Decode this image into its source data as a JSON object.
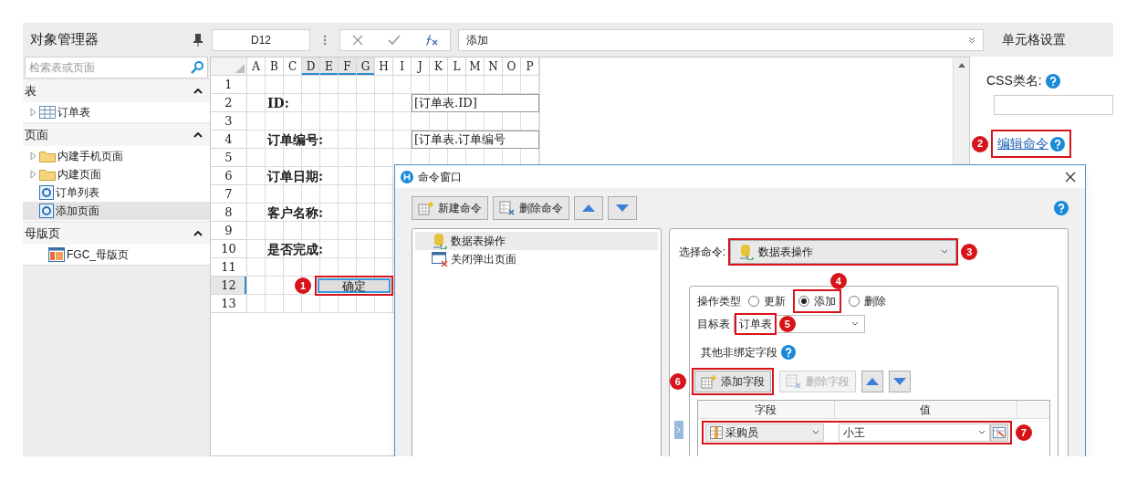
{
  "object_manager": {
    "title": "对象管理器",
    "search": {
      "placeholder": "检索表或页面"
    },
    "sections": [
      {
        "title": "表",
        "expanded": true,
        "items": [
          {
            "label": "订单表",
            "kind": "table",
            "expanded": false,
            "selected": false
          }
        ]
      },
      {
        "title": "页面",
        "expanded": true,
        "items": [
          {
            "label": "内建手机页面",
            "kind": "folder",
            "expanded": false,
            "selected": false
          },
          {
            "label": "内建页面",
            "kind": "folder",
            "expanded": false,
            "selected": false
          },
          {
            "label": "订单列表",
            "kind": "page",
            "selected": false
          },
          {
            "label": "添加页面",
            "kind": "page",
            "selected": true
          }
        ]
      },
      {
        "title": "母版页",
        "expanded": true,
        "items": [
          {
            "label": "FGC_母版页",
            "kind": "master",
            "selected": false
          }
        ]
      }
    ]
  },
  "formula_bar": {
    "cell_name": "D12",
    "formula": "添加"
  },
  "sheet": {
    "columns": [
      {
        "label": "A",
        "selected": false
      },
      {
        "label": "B",
        "selected": false
      },
      {
        "label": "C",
        "selected": false
      },
      {
        "label": "D",
        "selected": true
      },
      {
        "label": "E",
        "selected": true
      },
      {
        "label": "F",
        "selected": true
      },
      {
        "label": "G",
        "selected": true
      },
      {
        "label": "H",
        "selected": false
      },
      {
        "label": "I",
        "selected": false
      },
      {
        "label": "J",
        "selected": false
      },
      {
        "label": "K",
        "selected": false
      },
      {
        "label": "L",
        "selected": false
      },
      {
        "label": "M",
        "selected": false
      },
      {
        "label": "N",
        "selected": false
      },
      {
        "label": "O",
        "selected": false
      },
      {
        "label": "P",
        "selected": false
      }
    ],
    "rows": [
      {
        "number": "1",
        "selected": false
      },
      {
        "number": "2",
        "selected": false,
        "label": "ID:",
        "binding": "[订单表.ID]"
      },
      {
        "number": "3",
        "selected": false
      },
      {
        "number": "4",
        "selected": false,
        "label": "订单编号:",
        "binding": "[订单表.订单编号"
      },
      {
        "number": "5",
        "selected": false
      },
      {
        "number": "6",
        "selected": false,
        "label": "订单日期:"
      },
      {
        "number": "7",
        "selected": false
      },
      {
        "number": "8",
        "selected": false,
        "label": "客户名称:"
      },
      {
        "number": "9",
        "selected": false
      },
      {
        "number": "10",
        "selected": false,
        "label": "是否完成:"
      },
      {
        "number": "11",
        "selected": false
      },
      {
        "number": "12",
        "selected": true,
        "button": "确定",
        "callout": "1"
      },
      {
        "number": "13",
        "selected": false
      }
    ]
  },
  "cell_settings": {
    "title": "单元格设置",
    "css_label": "CSS类名:",
    "edit_command_link": "编辑命令",
    "callout": "2"
  },
  "command_window": {
    "title": "命令窗口",
    "toolbar": [
      {
        "kind": "new",
        "label": "新建命令"
      },
      {
        "kind": "delete",
        "label": "删除命令"
      },
      {
        "kind": "up"
      },
      {
        "kind": "down"
      }
    ],
    "commands": [
      {
        "label": "数据表操作",
        "kind": "data",
        "selected": true
      },
      {
        "label": "关闭弹出页面",
        "kind": "close",
        "selected": false
      }
    ],
    "select_command": {
      "label": "选择命令:",
      "value": "数据表操作",
      "callout": "3"
    },
    "operation_label": "操作类型",
    "operations": [
      {
        "label": "更新",
        "selected": false
      },
      {
        "label": "添加",
        "selected": true,
        "callout": "4"
      },
      {
        "label": "删除",
        "selected": false
      }
    ],
    "target_table": {
      "label": "目标表",
      "value": "订单表",
      "callout": "5"
    },
    "unbound_fields_label": "其他非绑定字段",
    "field_buttons": [
      {
        "kind": "add",
        "label": "添加字段",
        "disabled": false,
        "callout": "6"
      },
      {
        "kind": "delete",
        "label": "删除字段",
        "disabled": true
      },
      {
        "kind": "up",
        "disabled": false
      },
      {
        "kind": "down",
        "disabled": false
      }
    ],
    "fields_table": {
      "columns": [
        "字段",
        "值"
      ],
      "rows": [
        {
          "field": "采购员",
          "value": "小王",
          "callout": "7"
        }
      ]
    }
  }
}
